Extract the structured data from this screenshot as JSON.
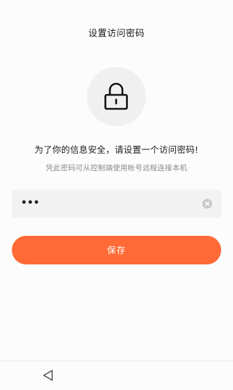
{
  "header": {
    "title": "设置访问密码"
  },
  "lock": {
    "icon": "lock-icon"
  },
  "message": {
    "headline": "为了你的信息安全，请设置一个访问密码!",
    "subtext": "凭此密码可从控制端使用帐号远程连接本机"
  },
  "password_input": {
    "value": "•••",
    "clear_icon": "clear-circle-icon"
  },
  "actions": {
    "save_label": "保存"
  },
  "navigation": {
    "back_icon": "triangle-back-icon"
  },
  "colors": {
    "accent": "#ff6a36",
    "background": "#fcfcfc",
    "input_bg": "#f2f2f2",
    "icon_circle_bg": "#f0f0f0"
  }
}
